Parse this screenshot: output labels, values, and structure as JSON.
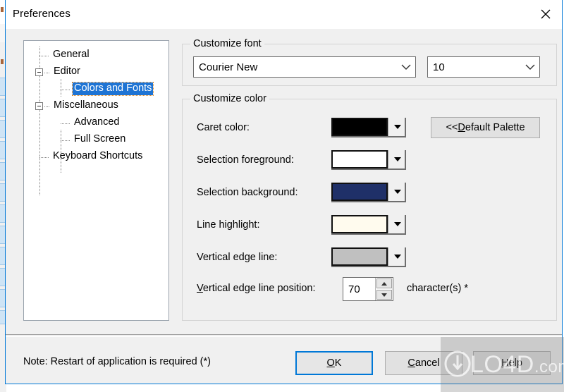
{
  "window": {
    "title": "Preferences",
    "close_icon": "close-icon"
  },
  "tree": {
    "items": [
      {
        "label": "General",
        "depth": 1,
        "expander": "none",
        "selected": false
      },
      {
        "label": "Editor",
        "depth": 0,
        "expander": "collapse",
        "selected": false
      },
      {
        "label": "Colors and Fonts",
        "depth": 2,
        "expander": "none",
        "selected": true
      },
      {
        "label": "Miscellaneous",
        "depth": 0,
        "expander": "collapse",
        "selected": false
      },
      {
        "label": "Advanced",
        "depth": 1,
        "expander": "none",
        "selected": false
      },
      {
        "label": "Full Screen",
        "depth": 1,
        "expander": "none",
        "selected": false
      },
      {
        "label": "Keyboard Shortcuts",
        "depth": 0,
        "expander": "none",
        "selected": false
      }
    ]
  },
  "font_group": {
    "title": "Customize font",
    "font_family": {
      "value": "Courier New",
      "chevron_icon": "chevron-down-icon"
    },
    "font_size": {
      "value": "10",
      "chevron_icon": "chevron-down-icon"
    }
  },
  "color_group": {
    "title": "Customize color",
    "rows": [
      {
        "label": "Caret color:",
        "color": "#000000",
        "arrow_icon": "triangle-down-icon"
      },
      {
        "label": "Selection foreground:",
        "color": "#FFFFFF",
        "arrow_icon": "triangle-down-icon"
      },
      {
        "label": "Selection background:",
        "color": "#1F3068",
        "arrow_icon": "triangle-down-icon"
      },
      {
        "label": "Line highlight:",
        "color": "#FFFBEE",
        "arrow_icon": "triangle-down-icon"
      },
      {
        "label": "Vertical edge line:",
        "color": "#C0C0C0",
        "arrow_icon": "triangle-down-icon"
      }
    ],
    "default_palette_button": {
      "prefix": "<< ",
      "accel": "D",
      "rest": "efault Palette"
    },
    "edge_position": {
      "label_accel": "V",
      "label_rest": "ertical edge line position:",
      "value": "70",
      "suffix": "character(s) *",
      "up_icon": "spinner-up-icon",
      "down_icon": "spinner-down-icon"
    }
  },
  "footer": {
    "note": "Note: Restart of application is required (*)",
    "buttons": [
      {
        "name": "ok",
        "accel": "O",
        "rest": "K",
        "prefix": ""
      },
      {
        "name": "cancel",
        "accel": "C",
        "rest": "ancel",
        "prefix": ""
      },
      {
        "name": "help",
        "accel": "H",
        "rest": "elp",
        "prefix": ""
      }
    ]
  },
  "watermark": {
    "text": "LO4D",
    "suffix": ".com"
  }
}
